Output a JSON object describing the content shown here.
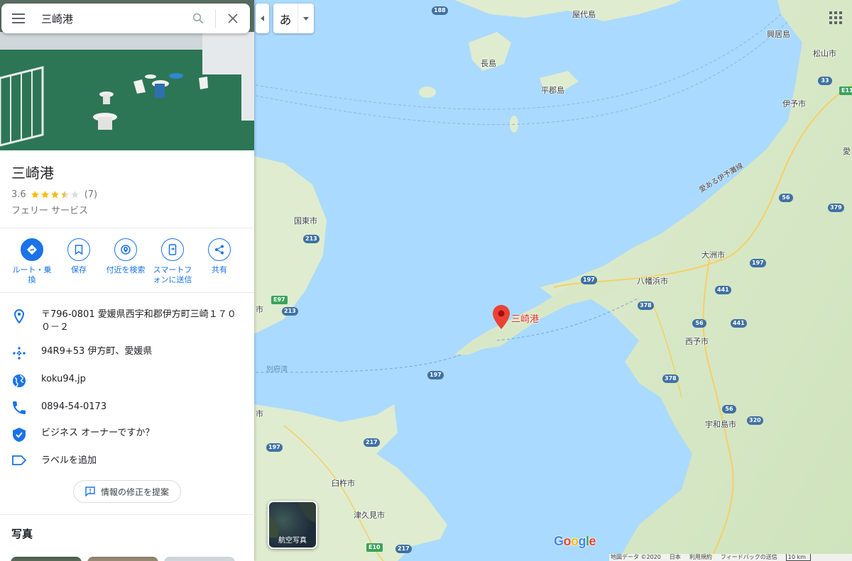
{
  "search": {
    "query": "三崎港",
    "menu_icon": "menu-icon",
    "search_icon": "search-icon",
    "clear_icon": "close-icon"
  },
  "ime": {
    "char": "あ"
  },
  "place": {
    "title": "三崎港",
    "rating": "3.6",
    "stars": 3.5,
    "review_count": "(7)",
    "category": "フェリー サービス"
  },
  "actions": [
    {
      "label": "ルート・乗換",
      "icon": "directions-icon"
    },
    {
      "label": "保存",
      "icon": "bookmark-icon"
    },
    {
      "label": "付近を検索",
      "icon": "nearby-icon"
    },
    {
      "label": "スマートフォンに送信",
      "icon": "send-to-phone-icon"
    },
    {
      "label": "共有",
      "icon": "share-icon"
    }
  ],
  "info": {
    "address": "〒796-0801 愛媛県西宇和郡伊方町三崎１７００－２",
    "plus_code": "94R9+53 伊方町、愛媛県",
    "website": "koku94.jp",
    "phone": "0894-54-0173",
    "business_owner": "ビジネス オーナーですか？",
    "add_label": "ラベルを追加"
  },
  "suggest_edit": "情報の修正を提案",
  "photos_heading": "写真",
  "map": {
    "pin_label": "三崎港",
    "places": [
      "屋代島",
      "長島",
      "平郡島",
      "興居島",
      "松山市",
      "伊予市",
      "国東市",
      "大洲市",
      "八幡浜市",
      "西予市",
      "宇和島市",
      "臼杵市",
      "津久見市",
      "市",
      "市",
      "愛"
    ],
    "sea_label": "別府湾",
    "route_name": "愛ある伊予灘線",
    "shields": [
      "188",
      "33",
      "E11",
      "56",
      "379",
      "197",
      "213",
      "213",
      "E97",
      "378",
      "441",
      "56",
      "441",
      "197",
      "378",
      "56",
      "320",
      "217",
      "217",
      "197",
      "E10"
    ]
  },
  "satellite_label": "航空写真",
  "logo": {
    "text": "Google",
    "colors": [
      "#4285f4",
      "#ea4335",
      "#fbbc05",
      "#4285f4",
      "#34a853",
      "#ea4335"
    ]
  },
  "footer": {
    "map_data": "地図データ ©2020",
    "country": "日本",
    "terms": "利用規約",
    "feedback": "フィードバックの送信",
    "scale": "10 km"
  },
  "colors": {
    "accent": "#1a73e8",
    "star": "#fbbc04",
    "pin": "#ea4335",
    "water": "#aadaff",
    "land": "#e8f0d9"
  }
}
